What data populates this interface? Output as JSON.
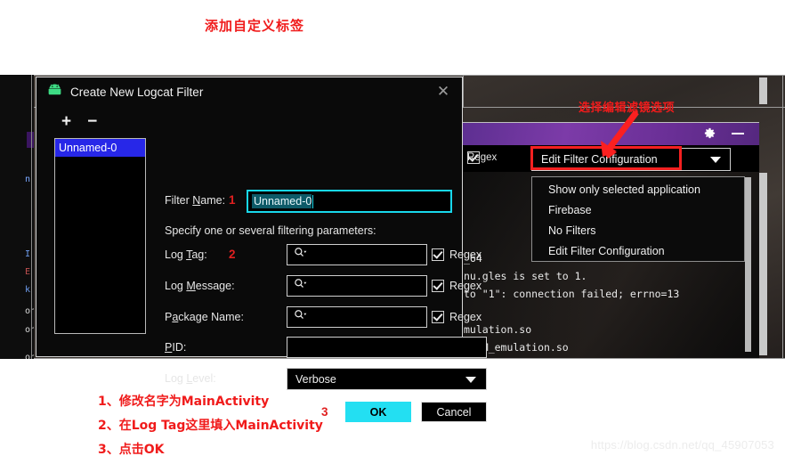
{
  "annotations": {
    "title": "添加自定义标签",
    "right_note": "选择编辑滤镜选项",
    "step1_marker": "1",
    "step2_marker": "2",
    "step3_marker": "3",
    "legend": [
      "1、修改名字为MainActivity",
      "2、在Log Tag这里填入MainActivity",
      "3、点击OK"
    ]
  },
  "dialog": {
    "title": "Create New Logcat Filter",
    "icon": "android-droid-icon",
    "close_icon": "close-icon",
    "add_button": "+",
    "remove_button": "−",
    "filter_list": [
      "Unnamed-0"
    ],
    "labels": {
      "filter_name": "Filter Name:",
      "hint": "Specify one or several filtering parameters:",
      "log_tag": "Log Tag:",
      "log_message": "Log Message:",
      "package_name": "Package Name:",
      "pid": "PID:",
      "log_level": "Log Level:"
    },
    "mnemonics": {
      "filter_name": "N",
      "log_tag": "T",
      "log_message": "M",
      "package_name": "a",
      "pid": "P",
      "log_level": "L"
    },
    "values": {
      "filter_name": "Unnamed-0",
      "log_tag": "",
      "log_message": "",
      "package_name": "",
      "pid": "",
      "log_level": "Verbose"
    },
    "regex_label": "Regex",
    "regex_checked": true,
    "buttons": {
      "ok": "OK",
      "cancel": "Cancel"
    },
    "colors": {
      "focus_border": "#18d8ec",
      "ok_button": "#23dff2",
      "list_selection": "#2727e8",
      "text_selection": "#0d5a68"
    }
  },
  "background_window": {
    "toolbar_regex_label": "Regex",
    "toolbar_regex_checked": true,
    "filter_combo_value": "Edit Filter Configuration",
    "gear_icon": "gear-icon",
    "minimize_icon": "minimize-icon",
    "dropdown_items": [
      "Show only selected application",
      "Firebase",
      "No Filters",
      "Edit Filter Configuration"
    ],
    "log_lines": [
      "_64",
      "nu.gles is set to 1.",
      "to \"1\": connection failed; errno=13",
      "",
      "mulation.so",
      "l_CM_emulation.so"
    ],
    "left_column_lines": [
      "n",
      "I",
      "E",
      "k",
      "on",
      "on",
      "on",
      "on"
    ],
    "highlight_color": "#f42020",
    "toolbar_color": "#6a2f96"
  },
  "watermark": "https://blog.csdn.net/qq_45907053"
}
